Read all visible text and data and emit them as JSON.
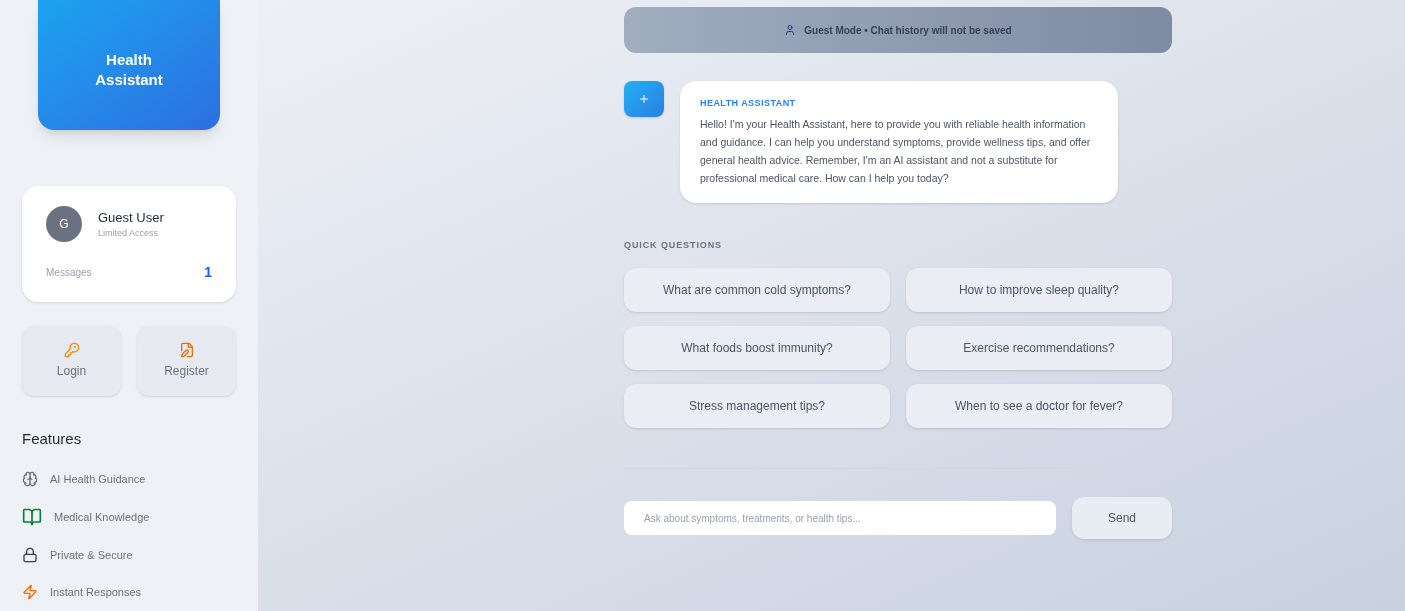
{
  "brand": {
    "title": "Health Assistant"
  },
  "profile": {
    "avatar": "G",
    "name": "Guest User",
    "role": "Limited Access",
    "stat_label": "Messages",
    "stat_value": "1"
  },
  "auth_buttons": [
    {
      "kind": "login",
      "label": "Login"
    },
    {
      "kind": "register",
      "label": "Register"
    }
  ],
  "features": {
    "heading": "Features",
    "items": [
      {
        "kind": "ai",
        "label": "AI Health Guidance"
      },
      {
        "kind": "knowledge",
        "label": "Medical Knowledge"
      },
      {
        "kind": "secure",
        "label": "Private & Secure"
      },
      {
        "kind": "instant",
        "label": "Instant Responses"
      }
    ]
  },
  "banner": {
    "text": "Guest Mode • Chat history will not be saved"
  },
  "messages": [
    {
      "sender": "HEALTH ASSISTANT",
      "text": "Hello! I'm your Health Assistant, here to provide you with reliable health information and guidance. I can help you understand symptoms, provide wellness tips, and offer general health advice. Remember, I'm an AI assistant and not a substitute for professional medical care. How can I help you today?"
    }
  ],
  "quick_questions": {
    "heading": "QUICK QUESTIONS",
    "columns": [
      [
        "What are common cold symptoms?",
        "What foods boost immunity?",
        "Stress management tips?"
      ],
      [
        "How to improve sleep quality?",
        "Exercise recommendations?",
        "When to see a doctor for fever?"
      ]
    ]
  },
  "composer": {
    "placeholder": "Ask about symptoms, treatments, or health tips...",
    "send": "Send"
  }
}
